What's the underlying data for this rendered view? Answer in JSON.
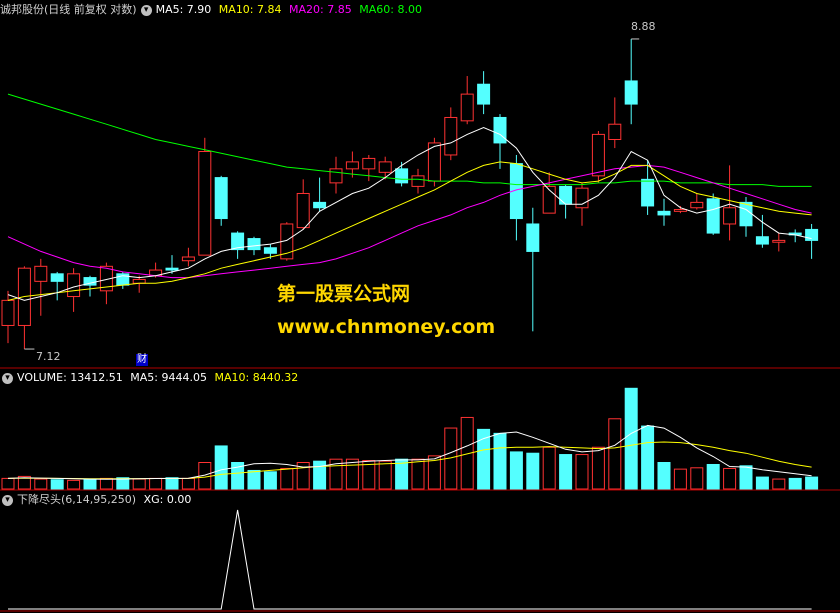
{
  "price_header": {
    "title": "诚邦股份(日线 前复权 对数)",
    "ma5": "MA5: 7.90",
    "ma10": "MA10: 7.84",
    "ma20": "MA20: 7.85",
    "ma60": "MA60: 8.00"
  },
  "volume_header": {
    "title": "VOLUME: 13412.51",
    "ma5": "MA5: 9444.05",
    "ma10": "MA10: 8440.32"
  },
  "indicator_header": {
    "title": "下降尽头(6,14,95,250)",
    "xg": "XG: 0.00"
  },
  "annotations": {
    "high_label": "8.88",
    "low_label": "7.12",
    "cai_label": "财"
  },
  "watermark": {
    "line1": "第一股票公式网",
    "line2": "www.chnmoney.com"
  },
  "colors": {
    "up": "#ff3232",
    "down": "#54ffff",
    "ma5": "#ffffff",
    "ma10": "#ffff00",
    "ma20": "#ff00ff",
    "ma60": "#00ff00",
    "frame": "#b00000",
    "watermark": "#ffd700"
  },
  "chart_data": {
    "type": "candlestick",
    "candles": [
      [
        7.25,
        7.38,
        7.43,
        7.16
      ],
      [
        7.25,
        7.55,
        7.56,
        7.13
      ],
      [
        7.48,
        7.56,
        7.6,
        7.3
      ],
      [
        7.52,
        7.48,
        7.53,
        7.38
      ],
      [
        7.4,
        7.52,
        7.55,
        7.32
      ],
      [
        7.5,
        7.46,
        7.51,
        7.4
      ],
      [
        7.43,
        7.56,
        7.58,
        7.36
      ],
      [
        7.52,
        7.46,
        7.53,
        7.44
      ],
      [
        7.47,
        7.49,
        7.51,
        7.42
      ],
      [
        7.51,
        7.54,
        7.58,
        7.5
      ],
      [
        7.55,
        7.54,
        7.62,
        7.52
      ],
      [
        7.59,
        7.61,
        7.66,
        7.56
      ],
      [
        7.62,
        8.2,
        8.28,
        7.62
      ],
      [
        8.05,
        7.82,
        8.06,
        7.78
      ],
      [
        7.74,
        7.65,
        7.75,
        7.6
      ],
      [
        7.71,
        7.65,
        7.72,
        7.62
      ],
      [
        7.66,
        7.63,
        7.68,
        7.6
      ],
      [
        7.6,
        7.79,
        7.8,
        7.59
      ],
      [
        7.77,
        7.96,
        8.04,
        7.76
      ],
      [
        7.91,
        7.88,
        8.05,
        7.86
      ],
      [
        8.02,
        8.1,
        8.17,
        7.96
      ],
      [
        8.1,
        8.14,
        8.2,
        8.05
      ],
      [
        8.1,
        8.16,
        8.18,
        8.03
      ],
      [
        8.08,
        8.14,
        8.17,
        8.04
      ],
      [
        8.1,
        8.02,
        8.14,
        8.0
      ],
      [
        8.0,
        8.06,
        8.1,
        7.96
      ],
      [
        8.03,
        8.25,
        8.28,
        8.0
      ],
      [
        8.18,
        8.4,
        8.46,
        8.15
      ],
      [
        8.38,
        8.54,
        8.65,
        8.36
      ],
      [
        8.6,
        8.48,
        8.68,
        8.42
      ],
      [
        8.4,
        8.25,
        8.42,
        8.1
      ],
      [
        8.13,
        7.82,
        8.18,
        7.7
      ],
      [
        7.79,
        7.64,
        7.88,
        7.22
      ],
      [
        7.85,
        8.0,
        8.08,
        7.85
      ],
      [
        8.0,
        7.9,
        8.01,
        7.82
      ],
      [
        7.88,
        7.99,
        8.02,
        7.78
      ],
      [
        8.06,
        8.3,
        8.32,
        8.02
      ],
      [
        8.27,
        8.36,
        8.52,
        8.22
      ],
      [
        8.62,
        8.48,
        8.88,
        8.36
      ],
      [
        8.04,
        7.89,
        8.15,
        7.84
      ],
      [
        7.86,
        7.84,
        7.93,
        7.78
      ],
      [
        7.86,
        7.87,
        7.89,
        7.85
      ],
      [
        7.88,
        7.91,
        7.96,
        7.87
      ],
      [
        7.93,
        7.74,
        7.96,
        7.73
      ],
      [
        7.79,
        7.88,
        8.12,
        7.7
      ],
      [
        7.91,
        7.78,
        7.94,
        7.72
      ],
      [
        7.72,
        7.68,
        7.84,
        7.66
      ],
      [
        7.69,
        7.7,
        7.74,
        7.64
      ],
      [
        7.74,
        7.73,
        7.76,
        7.69
      ],
      [
        7.76,
        7.7,
        7.79,
        7.6
      ]
    ],
    "candle_fields": [
      "open",
      "close",
      "high",
      "low"
    ],
    "ma5": [
      7.41,
      7.38,
      7.4,
      7.42,
      7.45,
      7.47,
      7.49,
      7.51,
      7.5,
      7.51,
      7.53,
      7.55,
      7.6,
      7.64,
      7.66,
      7.67,
      7.68,
      7.7,
      7.76,
      7.86,
      7.91,
      7.96,
      7.99,
      8.05,
      8.12,
      8.18,
      8.23,
      8.25,
      8.3,
      8.34,
      8.3,
      8.22,
      8.08,
      7.98,
      7.9,
      7.9,
      7.95,
      8.05,
      8.2,
      8.15,
      7.95,
      7.88,
      7.85,
      7.87,
      7.9,
      7.87,
      7.8,
      7.74,
      7.73,
      7.71
    ],
    "ma10": [
      7.38,
      7.4,
      7.41,
      7.42,
      7.43,
      7.44,
      7.45,
      7.46,
      7.47,
      7.47,
      7.48,
      7.5,
      7.52,
      7.55,
      7.57,
      7.59,
      7.61,
      7.63,
      7.66,
      7.7,
      7.74,
      7.78,
      7.82,
      7.86,
      7.9,
      7.94,
      7.98,
      8.03,
      8.08,
      8.12,
      8.14,
      8.13,
      8.1,
      8.07,
      8.04,
      8.02,
      8.03,
      8.07,
      8.12,
      8.12,
      8.06,
      8.0,
      7.96,
      7.94,
      7.92,
      7.9,
      7.88,
      7.86,
      7.85,
      7.84
    ],
    "ma20": [
      7.72,
      7.68,
      7.64,
      7.61,
      7.58,
      7.56,
      7.55,
      7.53,
      7.52,
      7.51,
      7.5,
      7.5,
      7.51,
      7.52,
      7.53,
      7.54,
      7.55,
      7.56,
      7.57,
      7.58,
      7.6,
      7.63,
      7.66,
      7.7,
      7.74,
      7.78,
      7.81,
      7.84,
      7.88,
      7.91,
      7.95,
      7.98,
      8.0,
      8.02,
      8.04,
      8.06,
      8.08,
      8.1,
      8.11,
      8.12,
      8.11,
      8.08,
      8.05,
      8.02,
      7.99,
      7.96,
      7.93,
      7.9,
      7.87,
      7.85
    ],
    "ma60": [
      8.54,
      8.51,
      8.48,
      8.45,
      8.42,
      8.39,
      8.36,
      8.33,
      8.3,
      8.27,
      8.25,
      8.23,
      8.21,
      8.19,
      8.17,
      8.15,
      8.13,
      8.11,
      8.1,
      8.09,
      8.08,
      8.07,
      8.06,
      8.05,
      8.04,
      8.04,
      8.03,
      8.03,
      8.03,
      8.02,
      8.02,
      8.01,
      8.01,
      8.01,
      8.01,
      8.01,
      8.02,
      8.02,
      8.03,
      8.03,
      8.03,
      8.02,
      8.02,
      8.02,
      8.01,
      8.01,
      8.01,
      8.0,
      8.0,
      8.0
    ],
    "volume": [
      1600,
      1900,
      1500,
      1400,
      1300,
      1500,
      1600,
      1700,
      1500,
      1600,
      1700,
      1600,
      4000,
      6500,
      4000,
      2800,
      2600,
      3100,
      4000,
      4200,
      4500,
      4500,
      4300,
      4200,
      4500,
      4500,
      5000,
      9200,
      10800,
      9000,
      8400,
      5600,
      5400,
      6300,
      5200,
      5200,
      6300,
      10600,
      15200,
      9500,
      4000,
      3000,
      3200,
      3700,
      3100,
      3500,
      1800,
      1500,
      1600,
      1800
    ],
    "vol_ma5": [
      1600,
      1700,
      1650,
      1600,
      1550,
      1500,
      1460,
      1500,
      1540,
      1580,
      1600,
      1620,
      2100,
      2900,
      3300,
      3800,
      3900,
      3700,
      3300,
      3400,
      3800,
      4000,
      4200,
      4300,
      4400,
      4400,
      4550,
      5500,
      6500,
      7600,
      8400,
      8600,
      7800,
      6900,
      6000,
      5600,
      5800,
      6600,
      8400,
      9600,
      9200,
      7800,
      6200,
      4900,
      3400,
      3300,
      2900,
      2600,
      2300,
      2000
    ],
    "vol_ma10": [
      1600,
      1650,
      1630,
      1600,
      1580,
      1560,
      1550,
      1560,
      1570,
      1580,
      1590,
      1600,
      1800,
      2200,
      2400,
      2600,
      2800,
      3000,
      3200,
      3400,
      3500,
      3600,
      3700,
      3800,
      3900,
      4100,
      4300,
      4700,
      5300,
      5900,
      6200,
      6300,
      6300,
      6400,
      6300,
      6200,
      6100,
      6200,
      6600,
      7000,
      7100,
      7000,
      6700,
      6300,
      5800,
      5400,
      4800,
      4200,
      3700,
      3300
    ],
    "xg": [
      0,
      0,
      0,
      0,
      0,
      0,
      0,
      0,
      0,
      0,
      0,
      0,
      0,
      0,
      1,
      0,
      0,
      0,
      0,
      0,
      0,
      0,
      0,
      0,
      0,
      0,
      0,
      0,
      0,
      0,
      0,
      0,
      0,
      0,
      0,
      0,
      0,
      0,
      0,
      0,
      0,
      0,
      0,
      0,
      0,
      0,
      0,
      0,
      0,
      0
    ],
    "ylim_price": [
      7.1,
      9.0
    ],
    "ylim_volume": [
      0,
      16000
    ],
    "ylim_xg": [
      0,
      1
    ],
    "grid": false,
    "scale": "log"
  }
}
